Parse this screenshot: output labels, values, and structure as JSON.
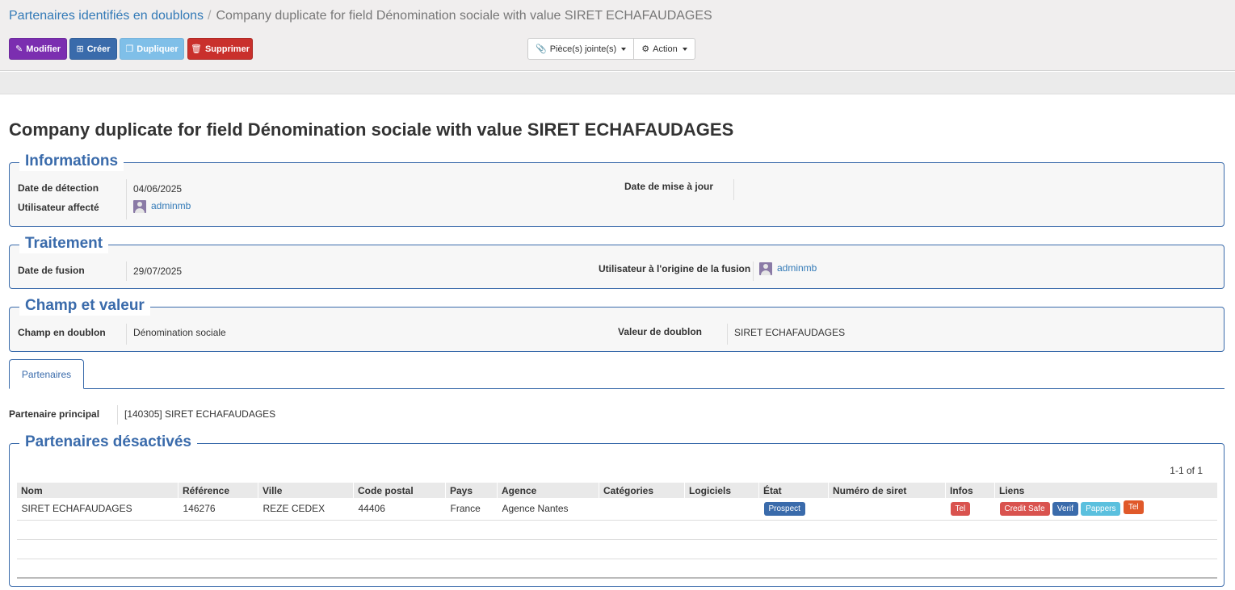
{
  "breadcrumb": {
    "parent": "Partenaires identifiés en doublons",
    "separator": "/",
    "current": "Company duplicate for field Dénomination sociale with value SIRET ECHAFAUDAGES"
  },
  "toolbar": {
    "modifier": "Modifier",
    "creer": "Créer",
    "dupliquer": "Dupliquer",
    "supprimer": "Supprimer",
    "pieces_jointes": "Pièce(s) jointe(s)",
    "action": "Action"
  },
  "title": "Company duplicate for field Dénomination sociale with value SIRET ECHAFAUDAGES",
  "informations": {
    "legend": "Informations",
    "date_detection_label": "Date de détection",
    "date_detection": "04/06/2025",
    "date_maj_label": "Date de mise à jour",
    "date_maj": "",
    "utilisateur_label": "Utilisateur affecté",
    "utilisateur": "adminmb"
  },
  "traitement": {
    "legend": "Traitement",
    "date_fusion_label": "Date de fusion",
    "date_fusion": "29/07/2025",
    "utilisateur_fusion_label": "Utilisateur à l'origine de la fusion",
    "utilisateur_fusion": "adminmb"
  },
  "champ": {
    "legend": "Champ et valeur",
    "champ_label": "Champ en doublon",
    "champ_value": "Dénomination sociale",
    "valeur_label": "Valeur de doublon",
    "valeur_value": "SIRET ECHAFAUDAGES"
  },
  "tabs": [
    {
      "label": "Partenaires"
    }
  ],
  "partenaire_principal": {
    "label": "Partenaire principal",
    "value": "[140305] SIRET ECHAFAUDAGES"
  },
  "desactives": {
    "legend": "Partenaires désactivés",
    "pager": "1-1 of 1",
    "columns": [
      "Nom",
      "Référence",
      "Ville",
      "Code postal",
      "Pays",
      "Agence",
      "Catégories",
      "Logiciels",
      "État",
      "Numéro de siret",
      "Infos",
      "Liens"
    ],
    "rows": [
      {
        "nom": "SIRET ECHAFAUDAGES",
        "reference": "146276",
        "ville": "REZE CEDEX",
        "code_postal": "44406",
        "pays": "France",
        "agence": "Agence Nantes",
        "categories": "",
        "logiciels": "",
        "etat": "Prospect",
        "siret": "",
        "infos": "Tel",
        "liens": [
          "Credit Safe",
          "Verif",
          "Pappers",
          "Tel"
        ]
      }
    ]
  },
  "colors": {
    "primary": "#3a6bab",
    "modifier": "#7b2eb0",
    "danger": "#c9302c",
    "info": "#5bc0de",
    "orange": "#e0592a"
  }
}
